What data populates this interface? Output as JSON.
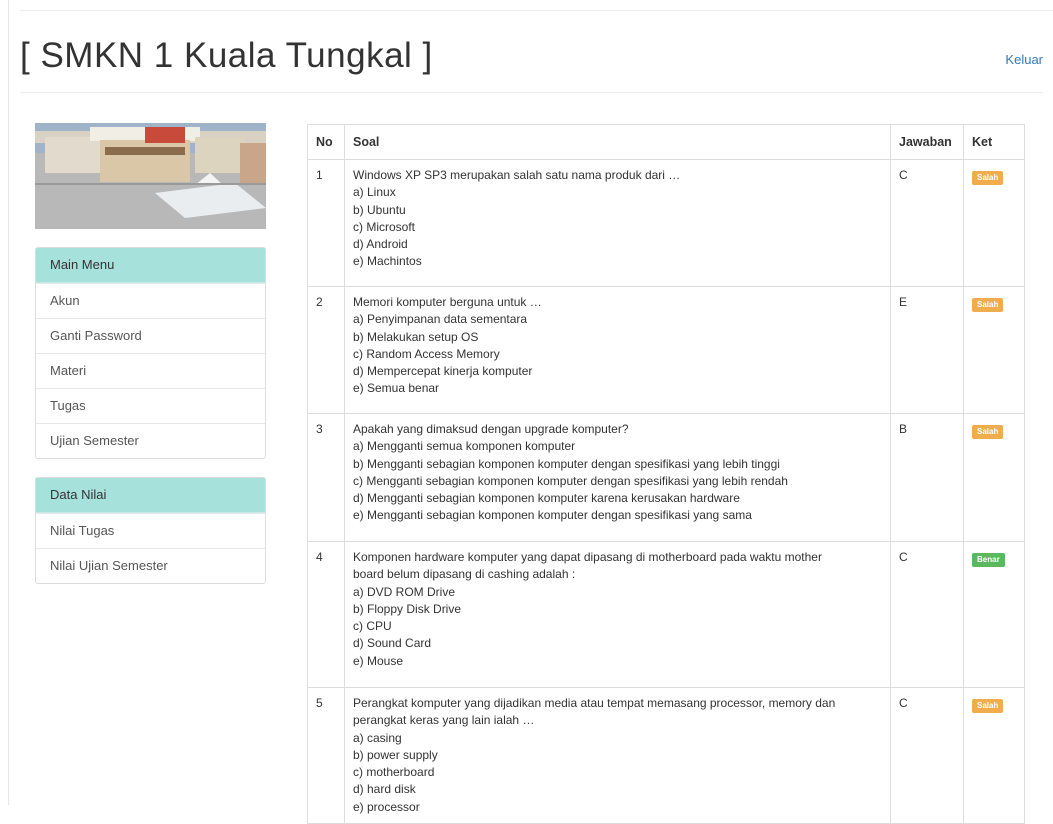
{
  "header": {
    "title": "[ SMKN 1 Kuala Tungkal ]",
    "logout_label": "Keluar"
  },
  "sidebar": {
    "main_menu": {
      "heading": "Main Menu",
      "items": [
        "Akun",
        "Ganti Password",
        "Materi",
        "Tugas",
        "Ujian Semester"
      ]
    },
    "data_nilai": {
      "heading": "Data Nilai",
      "items": [
        "Nilai Tugas",
        "Nilai Ujian Semester"
      ]
    }
  },
  "table": {
    "headers": {
      "no": "No",
      "soal": "Soal",
      "jawaban": "Jawaban",
      "ket": "Ket"
    },
    "rows": [
      {
        "no": "1",
        "soal": "Windows XP SP3 merupakan salah satu nama produk dari …\na) Linux\nb) Ubuntu\nc) Microsoft\nd) Android\ne) Machintos",
        "jawaban": "C",
        "ket": "Salah"
      },
      {
        "no": "2",
        "soal": "Memori komputer berguna untuk …\na) Penyimpanan data sementara\nb) Melakukan setup OS\nc) Random Access Memory\nd) Mempercepat kinerja komputer\ne) Semua benar",
        "jawaban": "E",
        "ket": "Salah"
      },
      {
        "no": "3",
        "soal": "Apakah yang dimaksud dengan upgrade komputer?\na) Mengganti semua komponen komputer\nb) Mengganti sebagian komponen komputer dengan spesifikasi yang lebih tinggi\nc) Mengganti sebagian komponen komputer dengan spesifikasi yang lebih rendah\nd) Mengganti sebagian komponen komputer karena kerusakan hardware\ne) Mengganti sebagian komponen komputer dengan spesifikasi yang sama",
        "jawaban": "B",
        "ket": "Salah"
      },
      {
        "no": "4",
        "soal": "Komponen hardware komputer yang dapat dipasang di motherboard pada waktu mother\nboard belum dipasang di cashing adalah :\na) DVD ROM Drive\nb) Floppy Disk Drive\nc) CPU\nd) Sound Card\ne) Mouse",
        "jawaban": "C",
        "ket": "Benar"
      },
      {
        "no": "5",
        "soal": "Perangkat komputer yang dijadikan media atau tempat memasang processor, memory dan\nperangkat keras yang lain ialah …\na) casing\nb) power supply\nc) motherboard\nd) hard disk\ne) processor",
        "jawaban": "C",
        "ket": "Salah"
      }
    ]
  }
}
